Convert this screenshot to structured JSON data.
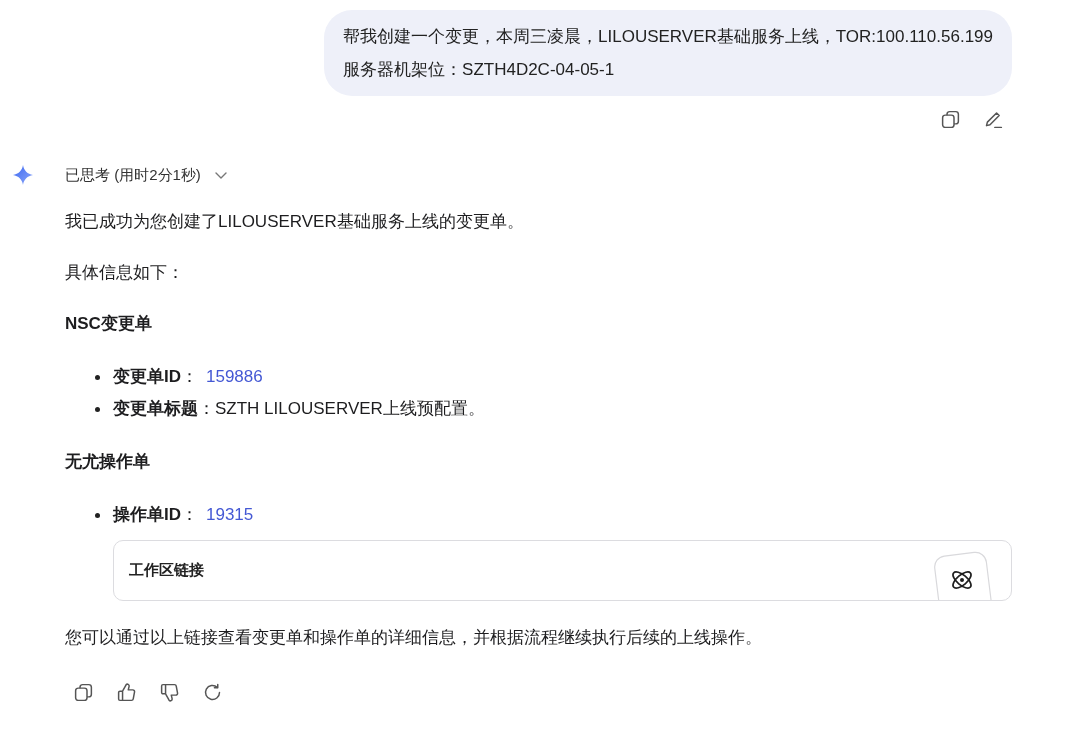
{
  "user_message": {
    "text": "帮我创建一个变更，本周三凌晨，LILOUSERVER基础服务上线，TOR:100.110.56.199\n服务器机架位：SZTH4D2C-04-05-1"
  },
  "reply": {
    "thinking": {
      "label": "已思考 (用时2分1秒)",
      "expanded": false
    },
    "blocks": [
      {
        "kind": "paragraph",
        "text": "我已成功为您创建了LILOUSERVER基础服务上线的变更单。"
      },
      {
        "kind": "paragraph",
        "text": "具体信息如下："
      },
      {
        "kind": "heading",
        "text": "NSC变更单"
      },
      {
        "kind": "list",
        "items": [
          {
            "kind": "link",
            "text": "**变更单ID**：",
            "link": "159886"
          },
          {
            "kind": "text",
            "text": "**变更单标题**：SZTH LILOUSERVER上线预配置。"
          }
        ]
      },
      {
        "kind": "heading",
        "text": "无尤操作单"
      },
      {
        "kind": "list",
        "items": [
          {
            "kind": "link",
            "text": "**操作单ID**：",
            "link": "19315",
            "attachment": {
              "title": "工作区链接"
            }
          }
        ]
      },
      {
        "kind": "paragraph",
        "text": "您可以通过以上链接查看变更单和操作单的详细信息，并根据流程继续执行后续的上线操作。"
      }
    ]
  }
}
